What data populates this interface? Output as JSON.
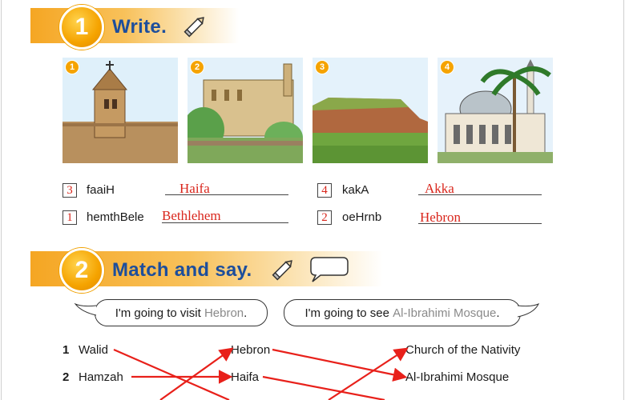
{
  "section1": {
    "number": "1",
    "title": "Write.",
    "photos": [
      {
        "number": "1",
        "scene": "church-of-the-nativity"
      },
      {
        "number": "2",
        "scene": "ibrahimi-mosque"
      },
      {
        "number": "3",
        "scene": "mountain-landscape"
      },
      {
        "number": "4",
        "scene": "mosque-with-palm"
      }
    ],
    "rows": [
      {
        "box": "3",
        "scrambled": "faaiH",
        "answer": "Haifa"
      },
      {
        "box": "4",
        "scrambled": "kakA",
        "answer": "Akka"
      },
      {
        "box": "1",
        "scrambled": "hemthBele",
        "answer": "Bethlehem"
      },
      {
        "box": "2",
        "scrambled": "oeHrnb",
        "answer": "Hebron"
      }
    ]
  },
  "section2": {
    "number": "2",
    "title": "Match and say.",
    "bubbles": [
      {
        "prefix": "I'm going to visit ",
        "highlight": "Hebron",
        "suffix": "."
      },
      {
        "prefix": "I'm going to see ",
        "highlight": "Al-Ibrahimi Mosque",
        "suffix": "."
      }
    ],
    "match_rows": [
      {
        "num": "1",
        "name": "Walid",
        "verb_word": "Hebron",
        "place": "Church of the Nativity"
      },
      {
        "num": "2",
        "name": "Hamzah",
        "verb_word": "Haifa",
        "place": "Al-Ibrahimi Mosque"
      }
    ]
  },
  "colors": {
    "banner": "#f5a623",
    "title": "#1d4e9c",
    "answer": "#d9261c",
    "match_line": "#e8201a"
  }
}
